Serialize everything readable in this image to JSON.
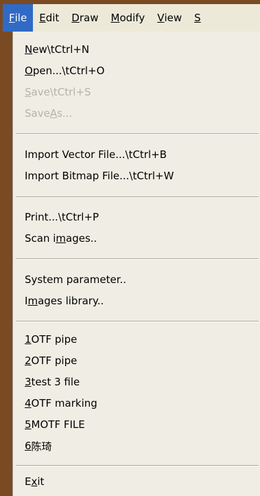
{
  "menubar": {
    "items": [
      {
        "accel": "F",
        "rest": "ile"
      },
      {
        "accel": "E",
        "rest": "dit"
      },
      {
        "accel": "D",
        "rest": "raw"
      },
      {
        "accel": "M",
        "rest": "odify"
      },
      {
        "accel": "V",
        "rest": "iew"
      },
      {
        "accel": "S",
        "rest": ""
      }
    ]
  },
  "file_menu": {
    "new": {
      "accel": "N",
      "rest": "ew\\tCtrl+N"
    },
    "open": {
      "accel": "O",
      "rest": "pen...\\tCtrl+O"
    },
    "save": {
      "accel": "S",
      "rest": "ave\\tCtrl+S"
    },
    "save_as": {
      "pre": "Save ",
      "accel": "A",
      "rest": "s..."
    },
    "import_vector": "Import Vector File...\\tCtrl+B",
    "import_bitmap": "Import Bitmap File...\\tCtrl+W",
    "print": "Print...\\tCtrl+P",
    "scan_images": {
      "pre": "Scan i",
      "accel": "m",
      "rest": "ages.."
    },
    "system_parameter": "System parameter..",
    "images_library": {
      "pre": "I",
      "accel": "m",
      "rest": "ages library.."
    },
    "recent_files": [
      {
        "num": "1",
        "name": " OTF pipe"
      },
      {
        "num": "2",
        "name": " OTF pipe"
      },
      {
        "num": "3",
        "name": " test 3 file"
      },
      {
        "num": "4",
        "name": " OTF marking"
      },
      {
        "num": "5",
        "name": " MOTF FILE"
      },
      {
        "num": "6",
        "name": " 陈琦"
      }
    ],
    "exit": {
      "pre": "E",
      "accel": "x",
      "rest": "it"
    }
  },
  "colors": {
    "menubar_bg": "#ece9d8",
    "active_item_bg": "#316ac5",
    "menu_bg": "#f0eee4",
    "disabled_text": "#b4b2aa",
    "window_frame": "#7a4a22"
  }
}
